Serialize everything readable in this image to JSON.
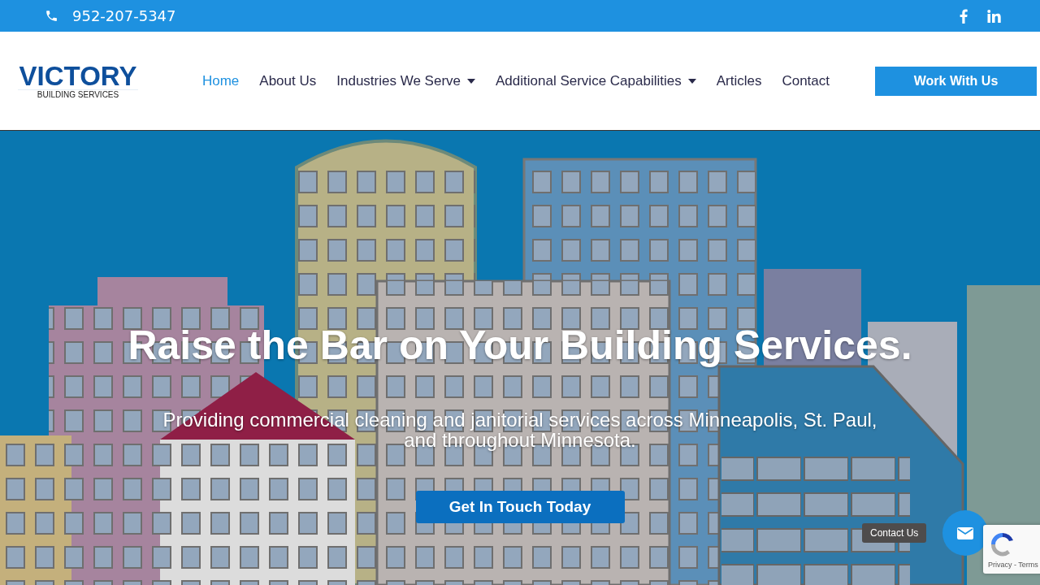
{
  "top_bar": {
    "phone": "952-207-5347"
  },
  "header": {
    "logo": {
      "title": "VICTORY",
      "subtitle": "BUILDING SERVICES"
    },
    "nav": [
      {
        "label": "Home",
        "selected": true,
        "has_dropdown": false
      },
      {
        "label": "About Us",
        "selected": false,
        "has_dropdown": false
      },
      {
        "label": "Industries We Serve",
        "selected": false,
        "has_dropdown": true
      },
      {
        "label": "Additional Service Capabilities",
        "selected": false,
        "has_dropdown": true
      },
      {
        "label": "Articles",
        "selected": false,
        "has_dropdown": false
      },
      {
        "label": "Contact",
        "selected": false,
        "has_dropdown": false
      }
    ],
    "cta": "Work With Us"
  },
  "hero": {
    "title": "Raise the Bar on Your Building Services.",
    "subtitle": "Providing commercial cleaning and janitorial services across Minneapolis, St. Paul, and throughout Minnesota.",
    "button": "Get In Touch Today"
  },
  "contact_widget": {
    "tooltip": "Contact Us"
  },
  "recaptcha": {
    "links": "Privacy - Terms"
  }
}
